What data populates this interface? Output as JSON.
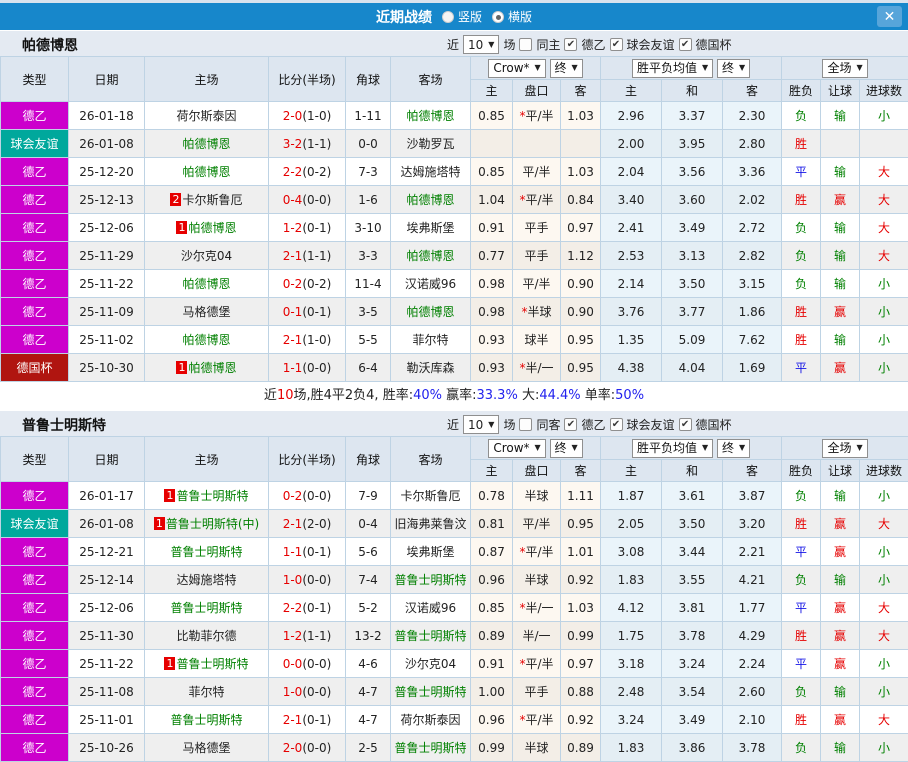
{
  "titlebar": {
    "title": "近期战绩",
    "layout_options": [
      {
        "label": "竖版",
        "selected": false
      },
      {
        "label": "横版",
        "selected": true
      }
    ],
    "close_icon": "✕"
  },
  "columns": {
    "main": [
      "类型",
      "日期",
      "主场",
      "比分(半场)",
      "角球",
      "客场"
    ],
    "odds_group": {
      "source_dropdown": "Crow*",
      "state_dropdown": "终",
      "cols": [
        "主",
        "盘口",
        "客"
      ]
    },
    "mean_group": {
      "source_dropdown": "胜平负均值",
      "state_dropdown": "终",
      "cols": [
        "主",
        "和",
        "客"
      ]
    },
    "result_group": {
      "scope_dropdown": "全场",
      "cols": [
        "胜负",
        "让球",
        "进球数"
      ]
    }
  },
  "type_colors": {
    "德乙": "#cc00cc",
    "球会友谊": "#00a89c",
    "德国杯": "#b01510"
  },
  "result_colors": {
    "胜": "#e60000",
    "平": "#1414e6",
    "负": "#008000",
    "赢": "#e60000",
    "输": "#008000",
    "大": "#e60000",
    "小": "#008000"
  },
  "sections": [
    {
      "team": "帕德博恩",
      "filter": {
        "near_label": "近",
        "count": "10",
        "games_label": "场",
        "same": {
          "label": "同主",
          "checked": false
        },
        "competitions": [
          {
            "label": "德乙",
            "checked": true
          },
          {
            "label": "球会友谊",
            "checked": true
          },
          {
            "label": "德国杯",
            "checked": true
          }
        ]
      },
      "rows": [
        {
          "type": "德乙",
          "date": "26-01-18",
          "home": "荷尔斯泰因",
          "home_rank": "",
          "home_tracked": false,
          "score": "2-0",
          "half": "(1-0)",
          "corner": "1-11",
          "away": "帕德博恩",
          "away_rank": "",
          "away_tracked": true,
          "odds": [
            "0.85",
            "*平/半",
            "1.03"
          ],
          "mean": [
            "2.96",
            "3.37",
            "2.30"
          ],
          "results": [
            "负",
            "输",
            "小"
          ]
        },
        {
          "type": "球会友谊",
          "date": "26-01-08",
          "home": "帕德博恩",
          "home_rank": "",
          "home_tracked": true,
          "score": "3-2",
          "half": "(1-1)",
          "corner": "0-0",
          "away": "沙勒罗瓦",
          "away_rank": "",
          "away_tracked": false,
          "odds": [
            "",
            "",
            ""
          ],
          "mean": [
            "2.00",
            "3.95",
            "2.80"
          ],
          "results": [
            "胜",
            "",
            ""
          ]
        },
        {
          "type": "德乙",
          "date": "25-12-20",
          "home": "帕德博恩",
          "home_rank": "",
          "home_tracked": true,
          "score": "2-2",
          "half": "(0-2)",
          "corner": "7-3",
          "away": "达姆施塔特",
          "away_rank": "",
          "away_tracked": false,
          "odds": [
            "0.85",
            "平/半",
            "1.03"
          ],
          "mean": [
            "2.04",
            "3.56",
            "3.36"
          ],
          "results": [
            "平",
            "输",
            "大"
          ]
        },
        {
          "type": "德乙",
          "date": "25-12-13",
          "home": "卡尔斯鲁厄",
          "home_rank": "2",
          "home_tracked": false,
          "score": "0-4",
          "half": "(0-0)",
          "corner": "1-6",
          "away": "帕德博恩",
          "away_rank": "",
          "away_tracked": true,
          "odds": [
            "1.04",
            "*平/半",
            "0.84"
          ],
          "mean": [
            "3.40",
            "3.60",
            "2.02"
          ],
          "results": [
            "胜",
            "赢",
            "大"
          ]
        },
        {
          "type": "德乙",
          "date": "25-12-06",
          "home": "帕德博恩",
          "home_rank": "1",
          "home_tracked": true,
          "score": "1-2",
          "half": "(0-1)",
          "corner": "3-10",
          "away": "埃弗斯堡",
          "away_rank": "",
          "away_tracked": false,
          "odds": [
            "0.91",
            "平手",
            "0.97"
          ],
          "mean": [
            "2.41",
            "3.49",
            "2.72"
          ],
          "results": [
            "负",
            "输",
            "大"
          ]
        },
        {
          "type": "德乙",
          "date": "25-11-29",
          "home": "沙尔克04",
          "home_rank": "",
          "home_tracked": false,
          "score": "2-1",
          "half": "(1-1)",
          "corner": "3-3",
          "away": "帕德博恩",
          "away_rank": "",
          "away_tracked": true,
          "odds": [
            "0.77",
            "平手",
            "1.12"
          ],
          "mean": [
            "2.53",
            "3.13",
            "2.82"
          ],
          "results": [
            "负",
            "输",
            "大"
          ]
        },
        {
          "type": "德乙",
          "date": "25-11-22",
          "home": "帕德博恩",
          "home_rank": "",
          "home_tracked": true,
          "score": "0-2",
          "half": "(0-2)",
          "corner": "11-4",
          "away": "汉诺威96",
          "away_rank": "",
          "away_tracked": false,
          "odds": [
            "0.98",
            "平/半",
            "0.90"
          ],
          "mean": [
            "2.14",
            "3.50",
            "3.15"
          ],
          "results": [
            "负",
            "输",
            "小"
          ]
        },
        {
          "type": "德乙",
          "date": "25-11-09",
          "home": "马格德堡",
          "home_rank": "",
          "home_tracked": false,
          "score": "0-1",
          "half": "(0-1)",
          "corner": "3-5",
          "away": "帕德博恩",
          "away_rank": "",
          "away_tracked": true,
          "odds": [
            "0.98",
            "*半球",
            "0.90"
          ],
          "mean": [
            "3.76",
            "3.77",
            "1.86"
          ],
          "results": [
            "胜",
            "赢",
            "小"
          ]
        },
        {
          "type": "德乙",
          "date": "25-11-02",
          "home": "帕德博恩",
          "home_rank": "",
          "home_tracked": true,
          "score": "2-1",
          "half": "(1-0)",
          "corner": "5-5",
          "away": "菲尔特",
          "away_rank": "",
          "away_tracked": false,
          "odds": [
            "0.93",
            "球半",
            "0.95"
          ],
          "mean": [
            "1.35",
            "5.09",
            "7.62"
          ],
          "results": [
            "胜",
            "输",
            "小"
          ]
        },
        {
          "type": "德国杯",
          "date": "25-10-30",
          "home": "帕德博恩",
          "home_rank": "1",
          "home_tracked": true,
          "score": "1-1",
          "half": "(0-0)",
          "corner": "6-4",
          "away": "勒沃库森",
          "away_rank": "",
          "away_tracked": false,
          "odds": [
            "0.93",
            "*半/一",
            "0.95"
          ],
          "mean": [
            "4.38",
            "4.04",
            "1.69"
          ],
          "results": [
            "平",
            "赢",
            "小"
          ]
        }
      ],
      "summary": {
        "segments": [
          {
            "text": "近",
            "color": "#222222"
          },
          {
            "text": "10",
            "color": "#e60000"
          },
          {
            "text": "场,胜4平2负4, 胜率:",
            "color": "#222222"
          },
          {
            "text": "40%",
            "color": "#2222ee"
          },
          {
            "text": " 赢率:",
            "color": "#222222"
          },
          {
            "text": "33.3%",
            "color": "#2222ee"
          },
          {
            "text": " 大:",
            "color": "#222222"
          },
          {
            "text": "44.4%",
            "color": "#2222ee"
          },
          {
            "text": " 单率:",
            "color": "#222222"
          },
          {
            "text": "50%",
            "color": "#2222ee"
          }
        ]
      }
    },
    {
      "team": "普鲁士明斯特",
      "filter": {
        "near_label": "近",
        "count": "10",
        "games_label": "场",
        "same": {
          "label": "同客",
          "checked": false
        },
        "competitions": [
          {
            "label": "德乙",
            "checked": true
          },
          {
            "label": "球会友谊",
            "checked": true
          },
          {
            "label": "德国杯",
            "checked": true
          }
        ]
      },
      "rows": [
        {
          "type": "德乙",
          "date": "26-01-17",
          "home": "普鲁士明斯特",
          "home_rank": "1",
          "home_tracked": true,
          "score": "0-2",
          "half": "(0-0)",
          "corner": "7-9",
          "away": "卡尔斯鲁厄",
          "away_rank": "",
          "away_tracked": false,
          "odds": [
            "0.78",
            "半球",
            "1.11"
          ],
          "mean": [
            "1.87",
            "3.61",
            "3.87"
          ],
          "results": [
            "负",
            "输",
            "小"
          ]
        },
        {
          "type": "球会友谊",
          "date": "26-01-08",
          "home": "普鲁士明斯特(中)",
          "home_rank": "1",
          "home_tracked": true,
          "score": "2-1",
          "half": "(2-0)",
          "corner": "0-4",
          "away": "旧海弗莱鲁汶",
          "away_rank": "",
          "away_tracked": false,
          "odds": [
            "0.81",
            "平/半",
            "0.95"
          ],
          "mean": [
            "2.05",
            "3.50",
            "3.20"
          ],
          "results": [
            "胜",
            "赢",
            "大"
          ]
        },
        {
          "type": "德乙",
          "date": "25-12-21",
          "home": "普鲁士明斯特",
          "home_rank": "",
          "home_tracked": true,
          "score": "1-1",
          "half": "(0-1)",
          "corner": "5-6",
          "away": "埃弗斯堡",
          "away_rank": "",
          "away_tracked": false,
          "odds": [
            "0.87",
            "*平/半",
            "1.01"
          ],
          "mean": [
            "3.08",
            "3.44",
            "2.21"
          ],
          "results": [
            "平",
            "赢",
            "小"
          ]
        },
        {
          "type": "德乙",
          "date": "25-12-14",
          "home": "达姆施塔特",
          "home_rank": "",
          "home_tracked": false,
          "score": "1-0",
          "half": "(0-0)",
          "corner": "7-4",
          "away": "普鲁士明斯特",
          "away_rank": "",
          "away_tracked": true,
          "odds": [
            "0.96",
            "半球",
            "0.92"
          ],
          "mean": [
            "1.83",
            "3.55",
            "4.21"
          ],
          "results": [
            "负",
            "输",
            "小"
          ]
        },
        {
          "type": "德乙",
          "date": "25-12-06",
          "home": "普鲁士明斯特",
          "home_rank": "",
          "home_tracked": true,
          "score": "2-2",
          "half": "(0-1)",
          "corner": "5-2",
          "away": "汉诺威96",
          "away_rank": "",
          "away_tracked": false,
          "odds": [
            "0.85",
            "*半/一",
            "1.03"
          ],
          "mean": [
            "4.12",
            "3.81",
            "1.77"
          ],
          "results": [
            "平",
            "赢",
            "大"
          ]
        },
        {
          "type": "德乙",
          "date": "25-11-30",
          "home": "比勒菲尔德",
          "home_rank": "",
          "home_tracked": false,
          "score": "1-2",
          "half": "(1-1)",
          "corner": "13-2",
          "away": "普鲁士明斯特",
          "away_rank": "",
          "away_tracked": true,
          "odds": [
            "0.89",
            "半/一",
            "0.99"
          ],
          "mean": [
            "1.75",
            "3.78",
            "4.29"
          ],
          "results": [
            "胜",
            "赢",
            "大"
          ]
        },
        {
          "type": "德乙",
          "date": "25-11-22",
          "home": "普鲁士明斯特",
          "home_rank": "1",
          "home_tracked": true,
          "score": "0-0",
          "half": "(0-0)",
          "corner": "4-6",
          "away": "沙尔克04",
          "away_rank": "",
          "away_tracked": false,
          "odds": [
            "0.91",
            "*平/半",
            "0.97"
          ],
          "mean": [
            "3.18",
            "3.24",
            "2.24"
          ],
          "results": [
            "平",
            "赢",
            "小"
          ]
        },
        {
          "type": "德乙",
          "date": "25-11-08",
          "home": "菲尔特",
          "home_rank": "",
          "home_tracked": false,
          "score": "1-0",
          "half": "(0-0)",
          "corner": "4-7",
          "away": "普鲁士明斯特",
          "away_rank": "",
          "away_tracked": true,
          "odds": [
            "1.00",
            "平手",
            "0.88"
          ],
          "mean": [
            "2.48",
            "3.54",
            "2.60"
          ],
          "results": [
            "负",
            "输",
            "小"
          ]
        },
        {
          "type": "德乙",
          "date": "25-11-01",
          "home": "普鲁士明斯特",
          "home_rank": "",
          "home_tracked": true,
          "score": "2-1",
          "half": "(0-1)",
          "corner": "4-7",
          "away": "荷尔斯泰因",
          "away_rank": "",
          "away_tracked": false,
          "odds": [
            "0.96",
            "*平/半",
            "0.92"
          ],
          "mean": [
            "3.24",
            "3.49",
            "2.10"
          ],
          "results": [
            "胜",
            "赢",
            "大"
          ]
        },
        {
          "type": "德乙",
          "date": "25-10-26",
          "home": "马格德堡",
          "home_rank": "",
          "home_tracked": false,
          "score": "2-0",
          "half": "(0-0)",
          "corner": "2-5",
          "away": "普鲁士明斯特",
          "away_rank": "",
          "away_tracked": true,
          "odds": [
            "0.99",
            "半球",
            "0.89"
          ],
          "mean": [
            "1.83",
            "3.86",
            "3.78"
          ],
          "results": [
            "负",
            "输",
            "小"
          ]
        }
      ]
    }
  ]
}
